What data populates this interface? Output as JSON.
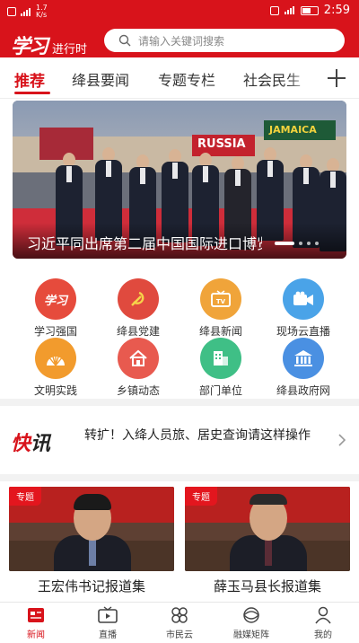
{
  "status_bar": {
    "carrier_small": "1.7 K/s",
    "time": "2:59"
  },
  "header": {
    "logo_script": "学习",
    "logo_sub": "进行时",
    "search_placeholder": "请输入关键词搜索"
  },
  "tabs": [
    {
      "label": "推荐",
      "active": true
    },
    {
      "label": "绛县要闻",
      "active": false
    },
    {
      "label": "专题专栏",
      "active": false
    },
    {
      "label": "社会民生",
      "active": false
    }
  ],
  "banner": {
    "title": "习近平同出席第二届中国国际进口博览会",
    "sign_left": "RUSSIA",
    "sign_right": "JAMAICA"
  },
  "grid": [
    {
      "label": "学习强国",
      "icon": "xuexi-icon",
      "color": "#e64b3c"
    },
    {
      "label": "绛县党建",
      "icon": "party-emblem-icon",
      "color": "#e04a3e"
    },
    {
      "label": "绛县新闻",
      "icon": "tv-icon",
      "color": "#f0a43a"
    },
    {
      "label": "现场云直播",
      "icon": "camera-icon",
      "color": "#4aa3e8"
    },
    {
      "label": "文明实践",
      "icon": "sun-rays-icon",
      "color": "#f29b2d"
    },
    {
      "label": "乡镇动态",
      "icon": "house-icon",
      "color": "#e85a4f"
    },
    {
      "label": "部门单位",
      "icon": "building-icon",
      "color": "#3fbf86"
    },
    {
      "label": "绛县政府网",
      "icon": "government-icon",
      "color": "#4a90e2"
    }
  ],
  "flash": {
    "logo_red": "快",
    "logo_dark": "讯",
    "text": "转扩！入绛人员旅、居史查询请这样操作"
  },
  "cards": [
    {
      "badge": "专题",
      "title": "王宏伟书记报道集"
    },
    {
      "badge": "专题",
      "title": "薛玉马县长报道集"
    }
  ],
  "bottom_nav": [
    {
      "label": "新闻",
      "icon": "news-icon",
      "active": true
    },
    {
      "label": "直播",
      "icon": "live-tv-icon",
      "active": false
    },
    {
      "label": "市民云",
      "icon": "apps-icon",
      "active": false
    },
    {
      "label": "融媒矩阵",
      "icon": "matrix-icon",
      "active": false
    },
    {
      "label": "我的",
      "icon": "user-icon",
      "active": false
    }
  ],
  "colors": {
    "brand_red": "#d8131b"
  }
}
